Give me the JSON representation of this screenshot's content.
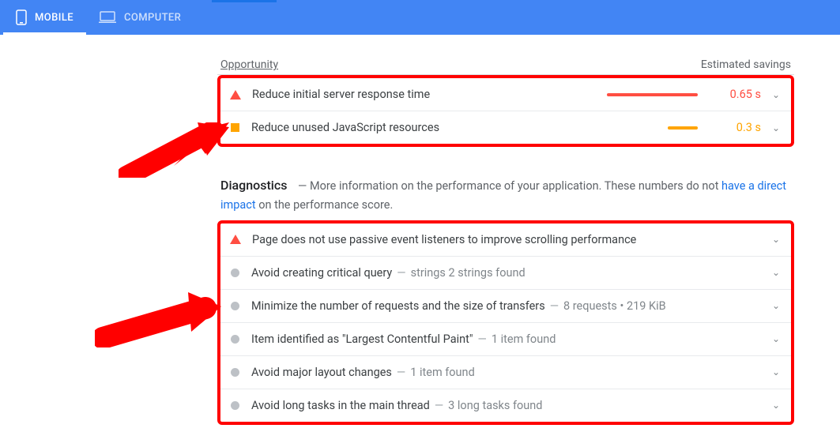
{
  "tabs": {
    "mobile": "MOBILE",
    "computer": "COMPUTER"
  },
  "opportunities": {
    "header_left": "Opportunity",
    "header_right": "Estimated savings",
    "rows": [
      {
        "title": "Reduce initial server response time",
        "savings": "0.65 s",
        "severity": "red"
      },
      {
        "title": "Reduce unused JavaScript resources",
        "savings": "0.3 s",
        "severity": "orange"
      }
    ]
  },
  "diagnostics": {
    "title": "Diagnostics",
    "desc_prefix": "— More information on the performance of your application. These numbers do not ",
    "link_text": "have a direct impact",
    "desc_suffix": " on the performance score.",
    "rows": [
      {
        "title": "Page does not use passive event listeners to improve scrolling performance",
        "sub": "",
        "severity": "red"
      },
      {
        "title": "Avoid creating critical query",
        "sub": "strings 2 strings found",
        "severity": "gray"
      },
      {
        "title": "Minimize the number of requests and the size of transfers",
        "sub": "8 requests • 219 KiB",
        "severity": "gray"
      },
      {
        "title": "Item identified as \"Largest Contentful Paint\"",
        "sub": "1 item found",
        "severity": "gray"
      },
      {
        "title": "Avoid major layout changes",
        "sub": "1 item found",
        "severity": "gray"
      },
      {
        "title": "Avoid long tasks in the main thread",
        "sub": "3 long tasks found",
        "severity": "gray"
      }
    ]
  }
}
